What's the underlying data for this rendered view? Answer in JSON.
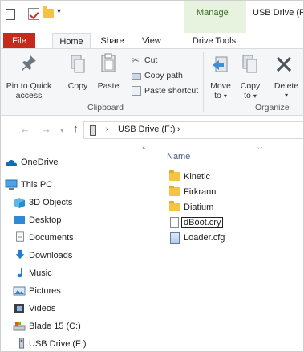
{
  "titlebar": {
    "contextual_tab_group": "Manage",
    "window_title": "USB Drive (F:)"
  },
  "ribbon_tabs": [
    {
      "label": "File"
    },
    {
      "label": "Home"
    },
    {
      "label": "Share"
    },
    {
      "label": "View"
    },
    {
      "label": "Drive Tools"
    }
  ],
  "ribbon": {
    "clipboard": {
      "pin_label_1": "Pin to Quick",
      "pin_label_2": "access",
      "copy_label": "Copy",
      "paste_label": "Paste",
      "cut_label": "Cut",
      "copy_path_label": "Copy path",
      "paste_shortcut_label": "Paste shortcut",
      "group_label": "Clipboard"
    },
    "organize": {
      "move_label_1": "Move",
      "move_label_2": "to",
      "copyto_label_1": "Copy",
      "copyto_label_2": "to",
      "delete_label": "Delete",
      "group_label": "Organize"
    }
  },
  "address": {
    "separator_1": "›",
    "location": "USB Drive (F:)",
    "separator_2": "›"
  },
  "nav_pane": {
    "items": [
      {
        "label": "OneDrive",
        "icon": "cloud-icon"
      },
      {
        "label": "This PC",
        "icon": "computer-icon"
      },
      {
        "label": "3D Objects",
        "icon": "cube-icon"
      },
      {
        "label": "Desktop",
        "icon": "desktop-icon"
      },
      {
        "label": "Documents",
        "icon": "documents-icon"
      },
      {
        "label": "Downloads",
        "icon": "download-arrow-icon"
      },
      {
        "label": "Music",
        "icon": "music-note-icon"
      },
      {
        "label": "Pictures",
        "icon": "pictures-icon"
      },
      {
        "label": "Videos",
        "icon": "film-icon"
      },
      {
        "label": "Blade 15 (C:)",
        "icon": "drive-icon"
      },
      {
        "label": "USB Drive (F:)",
        "icon": "usb-drive-icon"
      }
    ]
  },
  "content": {
    "column_header": "Name",
    "files": [
      {
        "name": "Kinetic",
        "type": "folder"
      },
      {
        "name": "Firkrann",
        "type": "folder"
      },
      {
        "name": "Diatium",
        "type": "folder"
      },
      {
        "name": "dBoot.cry",
        "type": "file",
        "renaming": true
      },
      {
        "name": "Loader.cfg",
        "type": "config"
      }
    ]
  },
  "colors": {
    "file_tab": "#c42b1c",
    "manage_bg": "#e8f3df",
    "manage_text": "#3c6e2b",
    "folder": "#f6c444",
    "selection": "#cce8ff"
  }
}
